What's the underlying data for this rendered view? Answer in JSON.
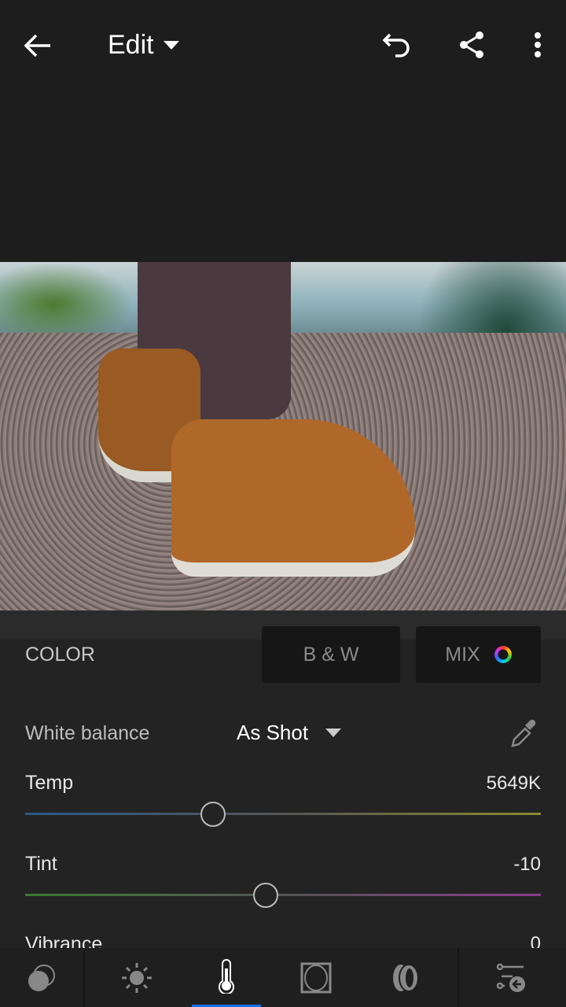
{
  "header": {
    "title": "Edit",
    "icons": [
      "back-arrow-icon",
      "caret-down-icon",
      "undo-icon",
      "share-icon",
      "more-vertical-icon"
    ]
  },
  "photo": {
    "subject": "sneakers on gravel"
  },
  "color_panel": {
    "section_label": "COLOR",
    "bw_button": "B & W",
    "mix_button": "MIX",
    "white_balance": {
      "label": "White balance",
      "value": "As Shot"
    },
    "sliders": [
      {
        "label": "Temp",
        "value": "5649K",
        "position": 0.365
      },
      {
        "label": "Tint",
        "value": "-10",
        "position": 0.467
      },
      {
        "label": "Vibrance",
        "value": "0"
      }
    ]
  },
  "toolbar": {
    "tabs": [
      "selective-icon",
      "light-icon",
      "color-icon",
      "effects-icon",
      "optics-icon",
      "presets-icon"
    ],
    "active": "color",
    "accent": "#1473e6"
  }
}
